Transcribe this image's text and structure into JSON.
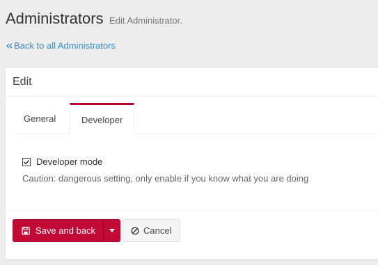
{
  "header": {
    "title": "Administrators",
    "subtitle": "Edit Administrator."
  },
  "nav": {
    "back_link": "Back to all Administrators",
    "back_icon": "double-chevron-left-icon"
  },
  "box": {
    "title": "Edit"
  },
  "tabs": [
    {
      "label": "General",
      "active": false
    },
    {
      "label": "Developer",
      "active": true
    }
  ],
  "developer_tab": {
    "checkbox_label": "Developer mode",
    "checked": true,
    "help_text": "Caution: dangerous setting, only enable if you know what you are doing"
  },
  "footer": {
    "save_label": "Save and back",
    "save_icon": "floppy-disk-icon",
    "dropdown_icon": "caret-down-icon",
    "cancel_label": "Cancel",
    "cancel_icon": "ban-icon"
  },
  "colors": {
    "accent": "#c10a35",
    "link": "#3c8dbc",
    "background": "#ececec"
  }
}
